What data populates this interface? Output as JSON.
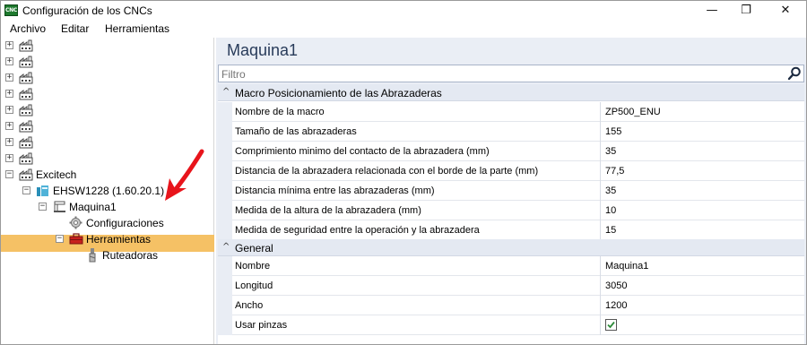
{
  "window": {
    "app_icon_text": "CNC",
    "title": "Configuración de los CNCs",
    "minimize_glyph": "—",
    "restore_glyph": "❐",
    "close_glyph": "✕"
  },
  "menu": [
    "Archivo",
    "Editar",
    "Herramientas"
  ],
  "tree": {
    "collapsed_count": 8,
    "expand_glyph": "+",
    "collapse_glyph": "−",
    "excitech_label": "Excitech",
    "ehsw_label": "EHSW1228 (1.60.20.1)",
    "maquina_label": "Maquina1",
    "configuraciones_label": "Configuraciones",
    "herramientas_label": "Herramientas",
    "ruteadoras_label": "Ruteadoras",
    "selection_color": "#f5c165"
  },
  "panel": {
    "title": "Maquina1",
    "filter_placeholder": "Filtro",
    "cat1_label": "Macro Posicionamiento de las Abrazaderas",
    "cat2_label": "General",
    "cat_chevron": "^",
    "props1": [
      {
        "name": "Nombre de la macro",
        "value": "ZP500_ENU"
      },
      {
        "name": "Tamaño de las abrazaderas",
        "value": "155"
      },
      {
        "name": "Comprimiento minimo del contacto de la abrazadera (mm)",
        "value": "35"
      },
      {
        "name": "Distancia de la abrazadera relacionada con el borde de la parte (mm)",
        "value": "77,5"
      },
      {
        "name": "Distancia mínima entre las abrazaderas (mm)",
        "value": "35"
      },
      {
        "name": "Medida de la altura de la abrazadera (mm)",
        "value": "10"
      },
      {
        "name": "Medida de seguridad entre la operación y la abrazadera",
        "value": "15"
      }
    ],
    "props2": [
      {
        "name": "Nombre",
        "value": "Maquina1"
      },
      {
        "name": "Longitud",
        "value": "3050"
      },
      {
        "name": "Ancho",
        "value": "1200"
      }
    ],
    "usar_pinzas_label": "Usar pinzas",
    "usar_pinzas_checked": true
  },
  "annotation": {
    "arrow_color": "#e8141b"
  }
}
